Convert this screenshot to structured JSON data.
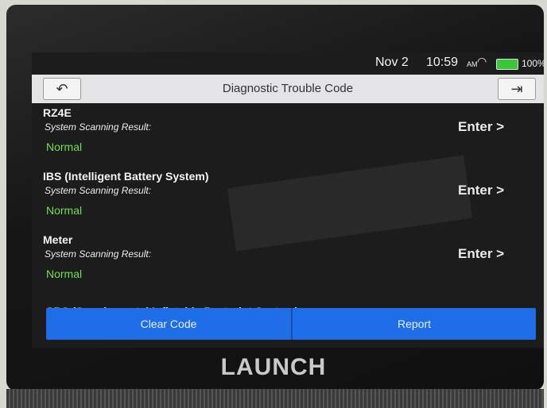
{
  "status_bar": {
    "date": "Nov 2",
    "time": "10:59",
    "ampm": "AM",
    "wifi_icon": "wifi-icon",
    "battery_percent": "100%"
  },
  "title_bar": {
    "title": "Diagnostic Trouble Code",
    "back_icon": "back-arrow-icon",
    "exit_icon": "exit-door-icon"
  },
  "systems": [
    {
      "name": "RZ4E",
      "result_label": "System Scanning Result:",
      "status": "Normal",
      "action": "Enter >"
    },
    {
      "name": "IBS (Intelligent Battery System)",
      "result_label": "System Scanning Result:",
      "status": "Normal",
      "action": "Enter >"
    },
    {
      "name": "Meter",
      "result_label": "System Scanning Result:",
      "status": "Normal",
      "action": "Enter >"
    }
  ],
  "partial_item": "SRS (Supplemental Inflatable Restraint System)",
  "bottom_bar": {
    "clear_label": "Clear Code",
    "report_label": "Report"
  },
  "brand": "LAUNCH",
  "colors": {
    "accent": "#1f6ee8",
    "status_ok": "#6de04e",
    "battery": "#39c839"
  }
}
